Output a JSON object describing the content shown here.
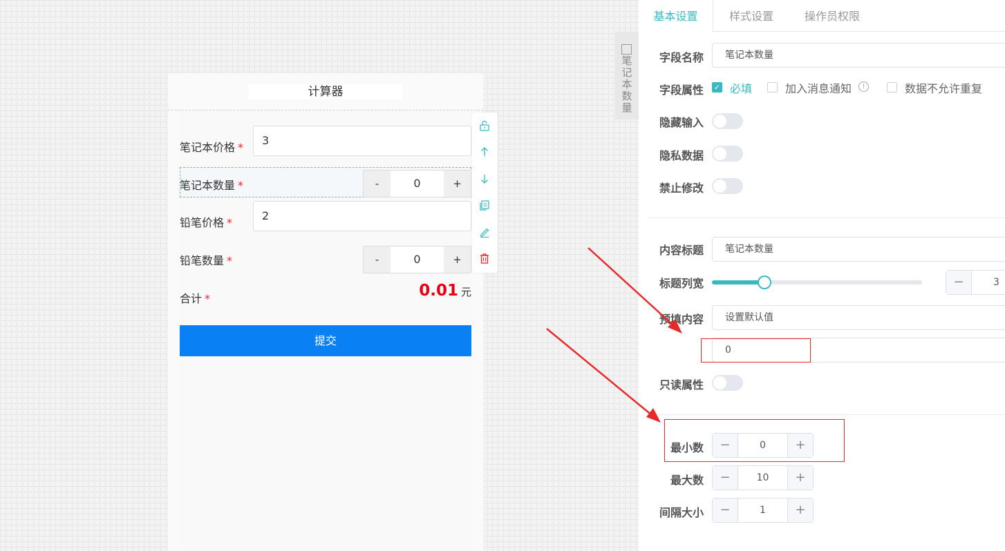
{
  "form": {
    "title": "计算器",
    "fields": [
      {
        "label": "笔记本价格",
        "value": "3"
      },
      {
        "label": "笔记本数量",
        "value": "0"
      },
      {
        "label": "铅笔价格",
        "value": "2"
      },
      {
        "label": "铅笔数量",
        "value": "0"
      }
    ],
    "required_mark": "*",
    "stepper_minus": "-",
    "stepper_plus": "+",
    "total_label": "合计",
    "total_value": "0.01",
    "total_unit": "元",
    "submit_label": "提交"
  },
  "toolbar": {
    "icons": [
      "lock-icon",
      "arrow-up-icon",
      "arrow-down-icon",
      "copy-icon",
      "edit-icon",
      "delete-icon"
    ],
    "accent_color": "#3ab8c1",
    "delete_color": "#f5222d"
  },
  "widget_tab": {
    "label": "笔记本数量",
    "icon": "number-icon"
  },
  "panel": {
    "tabs": [
      "基本设置",
      "样式设置",
      "操作员权限"
    ],
    "active_tab": "基本设置",
    "field_name_label": "字段名称",
    "field_name_value": "笔记本数量",
    "field_attr_label": "字段属性",
    "chk_required": "必填",
    "chk_notify": "加入消息通知",
    "chk_no_dup": "数据不允许重复",
    "hide_input_label": "隐藏输入",
    "private_data_label": "隐私数据",
    "no_modify_label": "禁止修改",
    "content_title_label": "内容标题",
    "content_title_value": "笔记本数量",
    "title_width_label": "标题列宽",
    "title_width_value": "3",
    "title_width_fraction": 0.25,
    "prefill_label": "预填内容",
    "prefill_mode": "设置默认值",
    "prefill_value": "0",
    "readonly_label": "只读属性",
    "min_label": "最小数",
    "min_value": "0",
    "max_label": "最大数",
    "max_value": "10",
    "step_label": "间隔大小",
    "step_value": "1",
    "minus": "−",
    "plus": "+"
  },
  "colors": {
    "accent": "#3ab8c1",
    "submit": "#0a80f5",
    "total": "#e60012",
    "annotation": "#e8292b"
  }
}
